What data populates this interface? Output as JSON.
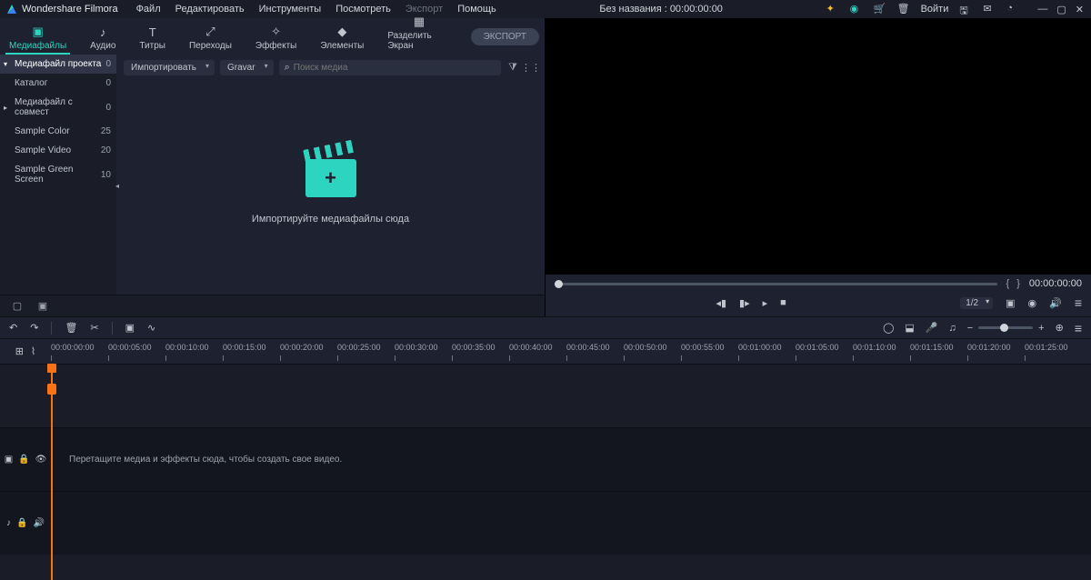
{
  "app": {
    "title": "Wondershare Filmora"
  },
  "menu": [
    "Файл",
    "Редактировать",
    "Инструменты",
    "Посмотреть",
    "Экспорт",
    "Помощь"
  ],
  "menu_disabled_idx": 4,
  "titlebar": {
    "project": "Без названия : 00:00:00:00",
    "login": "Войти"
  },
  "ribbon": [
    {
      "label": "Медиафайлы",
      "icon": "folder",
      "active": true
    },
    {
      "label": "Аудио",
      "icon": "music"
    },
    {
      "label": "Титры",
      "icon": "T"
    },
    {
      "label": "Переходы",
      "icon": "transition"
    },
    {
      "label": "Эффекты",
      "icon": "sparkle"
    },
    {
      "label": "Элементы",
      "icon": "shapes"
    },
    {
      "label": "Разделить Экран",
      "icon": "split"
    }
  ],
  "export_btn": "ЭКСПОРТ",
  "sidebar": [
    {
      "label": "Медиафайл проекта",
      "count": "0",
      "active": true,
      "arrow": "▾"
    },
    {
      "label": "Каталог",
      "count": "0"
    },
    {
      "label": "Медиафайл с совмест",
      "count": "0",
      "arrow": "▸"
    },
    {
      "label": "Sample Color",
      "count": "25"
    },
    {
      "label": "Sample Video",
      "count": "20"
    },
    {
      "label": "Sample Green Screen",
      "count": "10"
    }
  ],
  "content_toolbar": {
    "import": "Импортировать",
    "record": "Gravar",
    "search_placeholder": "Поиск медиа"
  },
  "drop_zone_text": "Импортируйте медиафайлы сюда",
  "preview": {
    "time": "00:00:00:00",
    "zoom": "1/2"
  },
  "ruler_ticks": [
    "00:00:00:00",
    "00:00:05:00",
    "00:00:10:00",
    "00:00:15:00",
    "00:00:20:00",
    "00:00:25:00",
    "00:00:30:00",
    "00:00:35:00",
    "00:00:40:00",
    "00:00:45:00",
    "00:00:50:00",
    "00:00:55:00",
    "00:01:00:00",
    "00:01:05:00",
    "00:01:10:00",
    "00:01:15:00",
    "00:01:20:00",
    "00:01:25:00"
  ],
  "track_hint": "Перетащите медиа и эффекты сюда, чтобы создать свое видео."
}
